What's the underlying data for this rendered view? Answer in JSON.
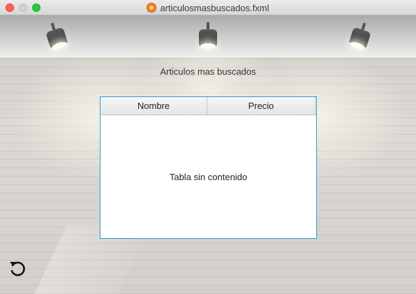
{
  "window": {
    "title": "articulosmasbuscados.fxml"
  },
  "page": {
    "heading": "Articulos mas buscados"
  },
  "table": {
    "columns": [
      "Nombre",
      "Precio"
    ],
    "empty_text": "Tabla sin contenido"
  },
  "icons": {
    "app": "fxml-app-icon",
    "refresh": "refresh-icon"
  },
  "colors": {
    "table_border": "#2e9bd0",
    "close": "#fe5f57",
    "maximize": "#28c840"
  }
}
